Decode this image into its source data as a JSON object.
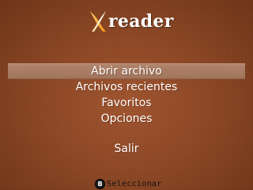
{
  "app": {
    "logo_text": "reader",
    "logo_icon": "x-logo-icon",
    "accent_color": "#f5a623"
  },
  "menu": {
    "selected_index": 0,
    "items": [
      {
        "label": "Abrir archivo"
      },
      {
        "label": "Archivos recientes"
      },
      {
        "label": "Favoritos"
      },
      {
        "label": "Opciones"
      },
      {
        "label": "Salir"
      }
    ]
  },
  "footer": {
    "button_glyph": "B",
    "action_label": "Seleccionar"
  },
  "colors": {
    "background": "#8e4826",
    "highlight": "#a97c63",
    "text": "#ffffff"
  }
}
